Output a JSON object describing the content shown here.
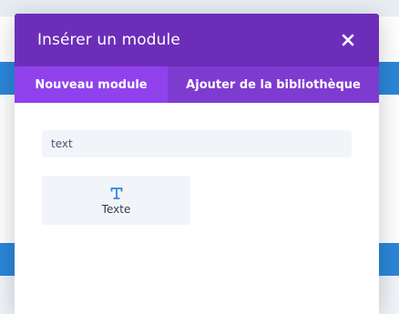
{
  "modal": {
    "title": "Insérer un module",
    "close_icon": "close-icon"
  },
  "tabs": [
    {
      "label": "Nouveau module",
      "active": true
    },
    {
      "label": "Ajouter de la bibliothèque",
      "active": false
    }
  ],
  "search": {
    "value": "text",
    "placeholder": ""
  },
  "modules": [
    {
      "label": "Texte",
      "icon": "text-icon"
    }
  ],
  "colors": {
    "header": "#6c2eb9",
    "tab_active": "#8f42ec",
    "tab_inactive": "#7e3bd0",
    "accent_blue": "#2b87da",
    "tile_bg": "#f1f5f9"
  }
}
